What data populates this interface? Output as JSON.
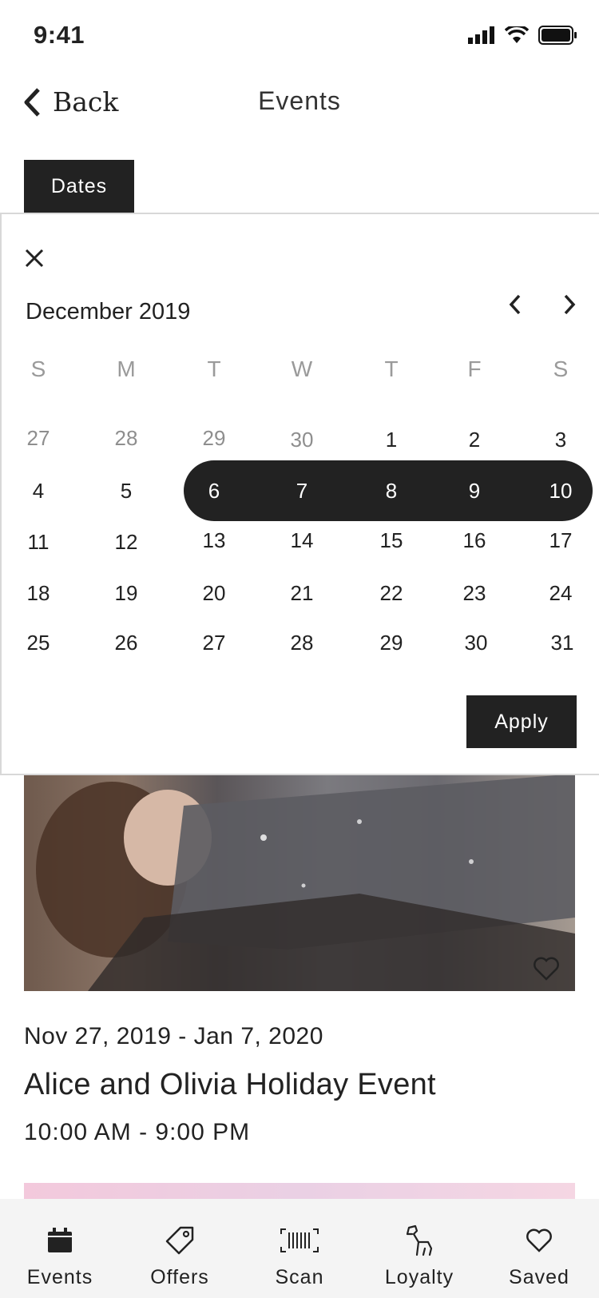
{
  "status_bar": {
    "time": "9:41"
  },
  "nav": {
    "back_label": "Back",
    "title": "Events"
  },
  "filter": {
    "dates_label": "Dates"
  },
  "calendar": {
    "month_label": "December 2019",
    "weekdays": [
      "S",
      "M",
      "T",
      "W",
      "T",
      "F",
      "S"
    ],
    "weeks": [
      [
        "27",
        "28",
        "29",
        "30",
        "1",
        "2",
        "3"
      ],
      [
        "4",
        "5",
        "6",
        "7",
        "8",
        "9",
        "10"
      ],
      [
        "11",
        "12",
        "13",
        "14",
        "15",
        "16",
        "17"
      ],
      [
        "18",
        "19",
        "20",
        "21",
        "22",
        "23",
        "24"
      ],
      [
        "25",
        "26",
        "27",
        "28",
        "29",
        "30",
        "31"
      ]
    ],
    "selected_range": {
      "start": "6",
      "end": "10"
    },
    "apply_label": "Apply"
  },
  "event": {
    "date_range": "Nov 27, 2019 - Jan 7, 2020",
    "title": "Alice and Olivia Holiday Event",
    "hours": "10:00 AM - 9:00 PM"
  },
  "tabbar": {
    "items": [
      {
        "label": "Events",
        "icon": "calendar-icon"
      },
      {
        "label": "Offers",
        "icon": "tag-icon"
      },
      {
        "label": "Scan",
        "icon": "barcode-icon"
      },
      {
        "label": "Loyalty",
        "icon": "dog-icon"
      },
      {
        "label": "Saved",
        "icon": "heart-icon"
      }
    ]
  }
}
